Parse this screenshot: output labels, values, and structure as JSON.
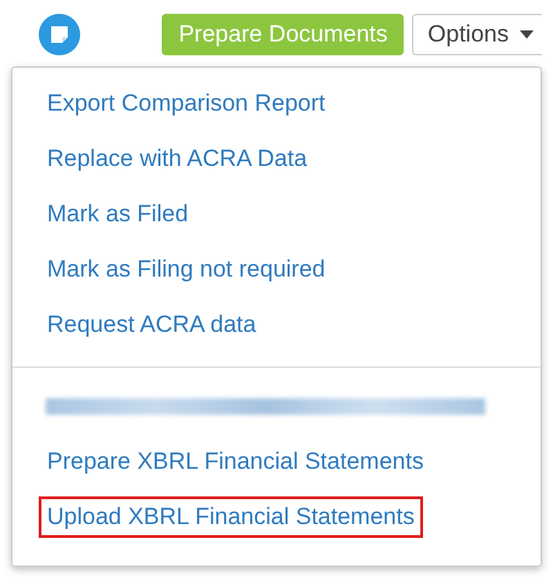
{
  "toolbar": {
    "primary_button": "Prepare Documents",
    "options_button": "Options"
  },
  "menu": {
    "sections": [
      {
        "items": [
          {
            "kind": "link",
            "label": "Export Comparison Report",
            "highlighted": false
          },
          {
            "kind": "link",
            "label": "Replace with ACRA Data",
            "highlighted": false
          },
          {
            "kind": "link",
            "label": "Mark as Filed",
            "highlighted": false
          },
          {
            "kind": "link",
            "label": "Mark as Filing not required",
            "highlighted": false
          },
          {
            "kind": "link",
            "label": "Request ACRA data",
            "highlighted": false
          }
        ]
      },
      {
        "items": [
          {
            "kind": "redacted"
          },
          {
            "kind": "link",
            "label": "Prepare XBRL Financial Statements",
            "highlighted": false
          },
          {
            "kind": "link",
            "label": "Upload XBRL Financial Statements",
            "highlighted": true
          }
        ]
      }
    ]
  }
}
